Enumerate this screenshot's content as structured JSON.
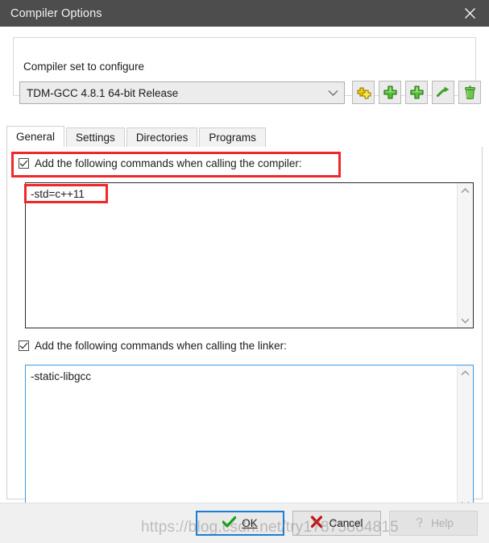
{
  "window": {
    "title": "Compiler Options",
    "close_icon": "close-icon"
  },
  "groupbox": {
    "title": "Compiler set to configure",
    "combo": {
      "value": "TDM-GCC 4.8.1 64-bit Release",
      "arrow_icon": "chevron-down-icon"
    },
    "tool_buttons": [
      {
        "name": "duplicate-compiler-set-button",
        "icon": "yellow-double-plus-icon",
        "tooltip": ""
      },
      {
        "name": "add-compiler-set-button",
        "icon": "green-plus-icon",
        "tooltip": ""
      },
      {
        "name": "add-compiler-set-button-2",
        "icon": "green-plus-icon",
        "tooltip": ""
      },
      {
        "name": "rename-compiler-set-button",
        "icon": "green-arrow-icon",
        "tooltip": ""
      },
      {
        "name": "delete-compiler-set-button",
        "icon": "green-trash-icon",
        "tooltip": ""
      }
    ]
  },
  "tabs": [
    {
      "label": "General",
      "active": true
    },
    {
      "label": "Settings",
      "active": false
    },
    {
      "label": "Directories",
      "active": false
    },
    {
      "label": "Programs",
      "active": false
    }
  ],
  "general": {
    "compiler": {
      "checkbox_label": "Add the following commands when calling the compiler:",
      "checked": true,
      "check_icon": "checkmark-icon",
      "text": "-std=c++11",
      "scroll_up_icon": "chevron-up-icon",
      "scroll_down_icon": "chevron-down-icon"
    },
    "linker": {
      "checkbox_label": "Add the following commands when calling the linker:",
      "checked": true,
      "check_icon": "checkmark-icon",
      "text": "-static-libgcc",
      "scroll_up_icon": "chevron-up-icon",
      "scroll_down_icon": "chevron-down-icon"
    }
  },
  "buttons": {
    "ok": {
      "label": "OK",
      "icon": "green-check-icon",
      "default": true
    },
    "cancel": {
      "label": "Cancel",
      "icon": "red-x-icon",
      "default": false
    },
    "help": {
      "label": "Help",
      "icon": "help-icon",
      "disabled": true
    }
  },
  "watermark": {
    "text": "https://blog.csdn.net/try17875864815"
  },
  "colors": {
    "titlebar": "#4d4d4d",
    "accent_blue": "#1a7fd4",
    "annotation_red": "#ef2929",
    "focus_border": "#3b9ae1"
  }
}
